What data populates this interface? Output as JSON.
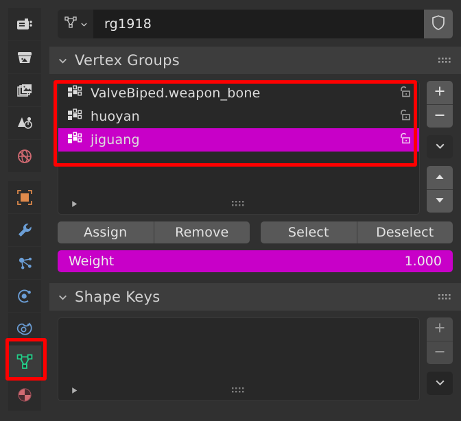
{
  "editor": {
    "name": "properties-editor",
    "accent_selected": "#c800c8",
    "annotation_color": "#ff0000",
    "background": "#303030"
  },
  "tabs": [
    {
      "name": "render",
      "icon": "camera-back-icon",
      "color": "#d4d4d4",
      "active": false
    },
    {
      "name": "output",
      "icon": "printer-icon",
      "color": "#d4d4d4",
      "active": false
    },
    {
      "name": "view-layer",
      "icon": "images-icon",
      "color": "#d4d4d4",
      "active": false
    },
    {
      "name": "scene",
      "icon": "cone-sphere-icon",
      "color": "#d4d4d4",
      "active": false
    },
    {
      "name": "world",
      "icon": "globe-icon",
      "color": "#d16a72",
      "active": false
    },
    {
      "name": "object",
      "icon": "orange-square-icon",
      "color": "#e08a4b",
      "active": false
    },
    {
      "name": "modifiers",
      "icon": "wrench-icon",
      "color": "#6b9ed6",
      "active": false
    },
    {
      "name": "particles",
      "icon": "particles-icon",
      "color": "#6b9ed6",
      "active": false
    },
    {
      "name": "physics",
      "icon": "physics-orbit-icon",
      "color": "#6b9ed6",
      "active": false
    },
    {
      "name": "constraints",
      "icon": "constraint-icon",
      "color": "#6b9ed6",
      "active": false
    },
    {
      "name": "object-data",
      "icon": "mesh-data-icon",
      "color": "#23d18b",
      "active": true
    },
    {
      "name": "material",
      "icon": "material-ball-icon",
      "color": "#d16a72",
      "active": false
    }
  ],
  "breadcrumb": {
    "datablock_icon": "mesh-data-icon",
    "dropdown_icon": "chevron-down-icon",
    "name_value": "rg1918",
    "name_placeholder": "Name",
    "fake_user_icon": "shield-icon"
  },
  "vertex_groups_panel": {
    "title": "Vertex Groups",
    "collapse_icon": "chevron-down-icon",
    "grip_icon": "grip-dots-icon",
    "items": [
      {
        "name": "ValveBiped.weapon_bone",
        "icon": "vertex-group-icon",
        "lock_icon": "unlock-icon",
        "selected": false
      },
      {
        "name": "huoyan",
        "icon": "vertex-group-icon",
        "lock_icon": "unlock-icon",
        "selected": false
      },
      {
        "name": "jiguang",
        "icon": "vertex-group-icon",
        "lock_icon": "unlock-icon",
        "selected": true
      }
    ],
    "buttons": {
      "add": "+",
      "remove": "−",
      "specials": "chevron-down-icon",
      "move_up": "triangle-up-icon",
      "move_down": "triangle-down-icon"
    },
    "footer": {
      "expand_icon": "triangle-right-icon",
      "grip_icon": "grip-dots-icon"
    },
    "actions": {
      "assign": "Assign",
      "remove": "Remove",
      "select": "Select",
      "deselect": "Deselect"
    },
    "weight": {
      "label": "Weight",
      "value": "1.000",
      "fill_percent": 100
    }
  },
  "shape_keys_panel": {
    "title": "Shape Keys",
    "collapse_icon": "chevron-down-icon",
    "grip_icon": "grip-dots-icon",
    "items": [],
    "buttons": {
      "add": "+",
      "remove": "−",
      "specials": "chevron-down-icon"
    },
    "footer": {
      "expand_icon": "triangle-right-icon",
      "grip_icon": "grip-dots-icon"
    }
  }
}
